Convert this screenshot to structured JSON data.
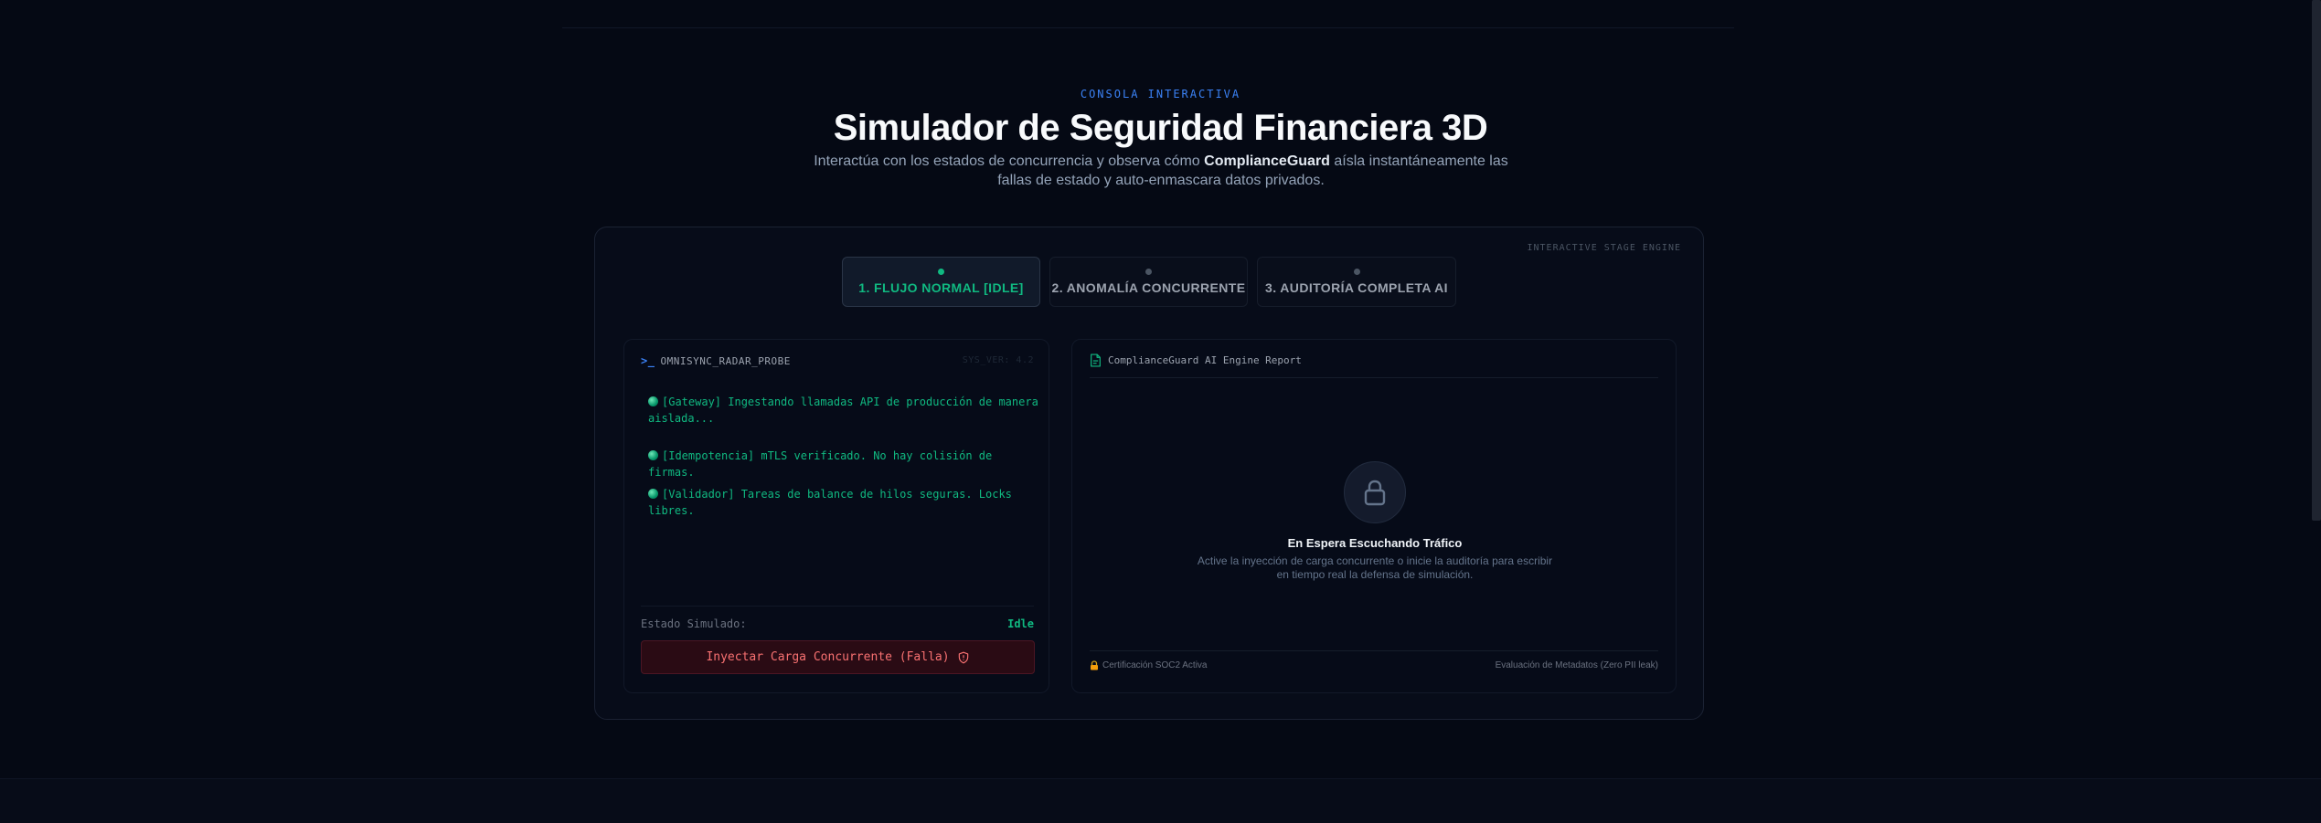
{
  "header": {
    "eyebrow": "CONSOLA INTERACTIVA",
    "title": "Simulador de Seguridad Financiera 3D",
    "subtitle_pre": "Interactúa con los estados de concurrencia y observa cómo ",
    "subtitle_brand": "ComplianceGuard",
    "subtitle_post": " aísla instantáneamente las fallas de estado y auto-enmascara datos privados."
  },
  "stage": {
    "tag": "INTERACTIVE STAGE ENGINE",
    "tabs": [
      {
        "label": "1. FLUJO NORMAL [IDLE]",
        "active": true
      },
      {
        "label": "2. ANOMALÍA CONCURRENTE",
        "active": false
      },
      {
        "label": "3. AUDITORÍA COMPLETA AI",
        "active": false
      }
    ]
  },
  "probe": {
    "title": "OMNISYNC_RADAR_PROBE",
    "version": "SYS_VER: 4.2",
    "logs": [
      "[Gateway] Ingestando llamadas API de producción de manera aislada...",
      "[Idempotencia] mTLS verificado. No hay colisión de firmas.",
      "[Validador] Tareas de balance de hilos seguras. Locks libres."
    ],
    "state_label": "Estado Simulado:",
    "state_value": "Idle",
    "inject_button": "Inyectar Carga Concurrente (Falla)"
  },
  "report": {
    "title": "ComplianceGuard AI Engine Report",
    "wait_title": "En Espera Escuchando Tráfico",
    "wait_desc": "Active la inyección de carga concurrente o inicie la auditoría para escribir en tiempo real la defensa de simulación.",
    "cert": "Certificación SOC2 Activa",
    "meta": "Evaluación de Metadatos (Zero PII leak)"
  },
  "colors": {
    "accent_green": "#10b981",
    "accent_blue": "#3b82f6",
    "danger": "#f87171",
    "background": "#050914"
  },
  "icons": {
    "probe": "terminal-prompt-icon",
    "report": "document-icon",
    "lock": "lock-icon",
    "shield": "shield-icon",
    "cert": "padlock-icon"
  }
}
